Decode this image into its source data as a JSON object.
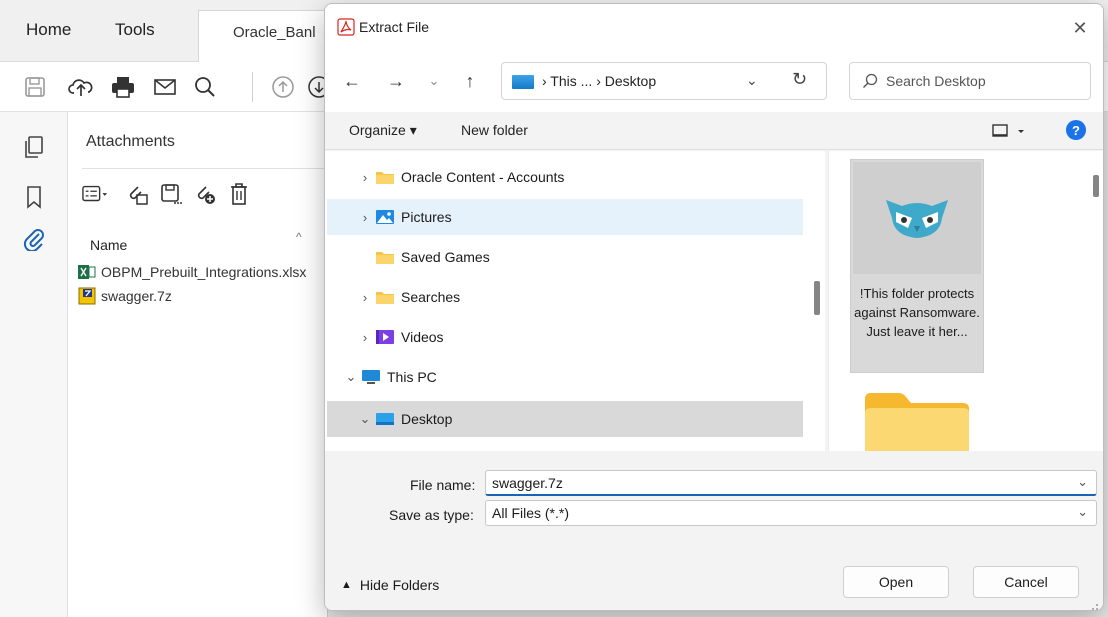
{
  "acrobat": {
    "menu": {
      "home": "Home",
      "tools": "Tools"
    },
    "doc_tab_title": "Oracle_Banl",
    "attachments_panel": {
      "title": "Attachments",
      "column_name": "Name",
      "files": [
        {
          "name": "OBPM_Prebuilt_Integrations.xlsx",
          "icon": "excel-file-icon"
        },
        {
          "name": "swagger.7z",
          "icon": "archive-file-icon"
        }
      ]
    }
  },
  "dialog": {
    "title": "Extract File",
    "close_glyph": "✕",
    "nav": {
      "back": "←",
      "forward": "→",
      "recent": "⌄",
      "up": "↑",
      "breadcrumb": "› This ... › Desktop",
      "dropdown": "⌄",
      "refresh": "↻"
    },
    "search": {
      "placeholder": "Search Desktop"
    },
    "commands": {
      "organize": "Organize ▾",
      "new_folder": "New folder",
      "help": "?"
    },
    "tree": [
      {
        "label": "Oracle Content - Accounts",
        "chevron": "›",
        "icon": "folder-icon"
      },
      {
        "label": "Pictures",
        "chevron": "›",
        "icon": "pictures-icon"
      },
      {
        "label": "Saved Games",
        "chevron": "",
        "icon": "folder-icon"
      },
      {
        "label": "Searches",
        "chevron": "›",
        "icon": "folder-icon"
      },
      {
        "label": "Videos",
        "chevron": "›",
        "icon": "videos-icon"
      },
      {
        "label": "This PC",
        "chevron": "⌄",
        "icon": "this-pc-icon"
      },
      {
        "label": "Desktop",
        "chevron": "⌄",
        "icon": "desktop-icon"
      }
    ],
    "files": {
      "selected_tile_label": "!This folder protects against Ransomware. Just leave it her..."
    },
    "fields": {
      "file_name_label": "File name:",
      "file_name_value": "swagger.7z",
      "save_type_label": "Save as type:",
      "save_type_value": "All Files (*.*)",
      "dropdown_glyph": "⌄"
    },
    "buttons": {
      "hide_folders": "Hide Folders",
      "hide_caret": "▲",
      "open": "Open",
      "cancel": "Cancel"
    }
  },
  "colors": {
    "accent": "#1a73e8",
    "folder": "#f8c24b",
    "selected_row": "#d9d9d9",
    "hover_row": "#e5f1fb",
    "acrobat_red": "#d7261e"
  }
}
